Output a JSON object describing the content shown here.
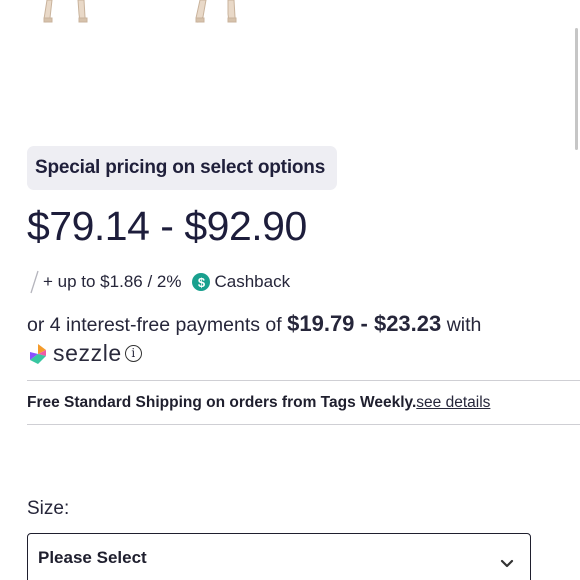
{
  "pricing": {
    "badge": "Special pricing on select options",
    "price_range": "$79.14 - $92.90"
  },
  "cashback": {
    "prefix": "+ up to $1.86 / 2%",
    "label": "Cashback",
    "icon": "dollar-circle-icon",
    "icon_glyph": "$",
    "icon_color": "#19a08e"
  },
  "installments": {
    "lead": "or 4 interest-free payments of",
    "amount": "$19.79 - $23.23",
    "trail": "with",
    "provider": "sezzle",
    "info_glyph": "i"
  },
  "shipping": {
    "text": "Free Standard Shipping on orders from Tags Weekly.",
    "link": "see details"
  },
  "size": {
    "label": "Size:",
    "selected": "Please Select"
  }
}
